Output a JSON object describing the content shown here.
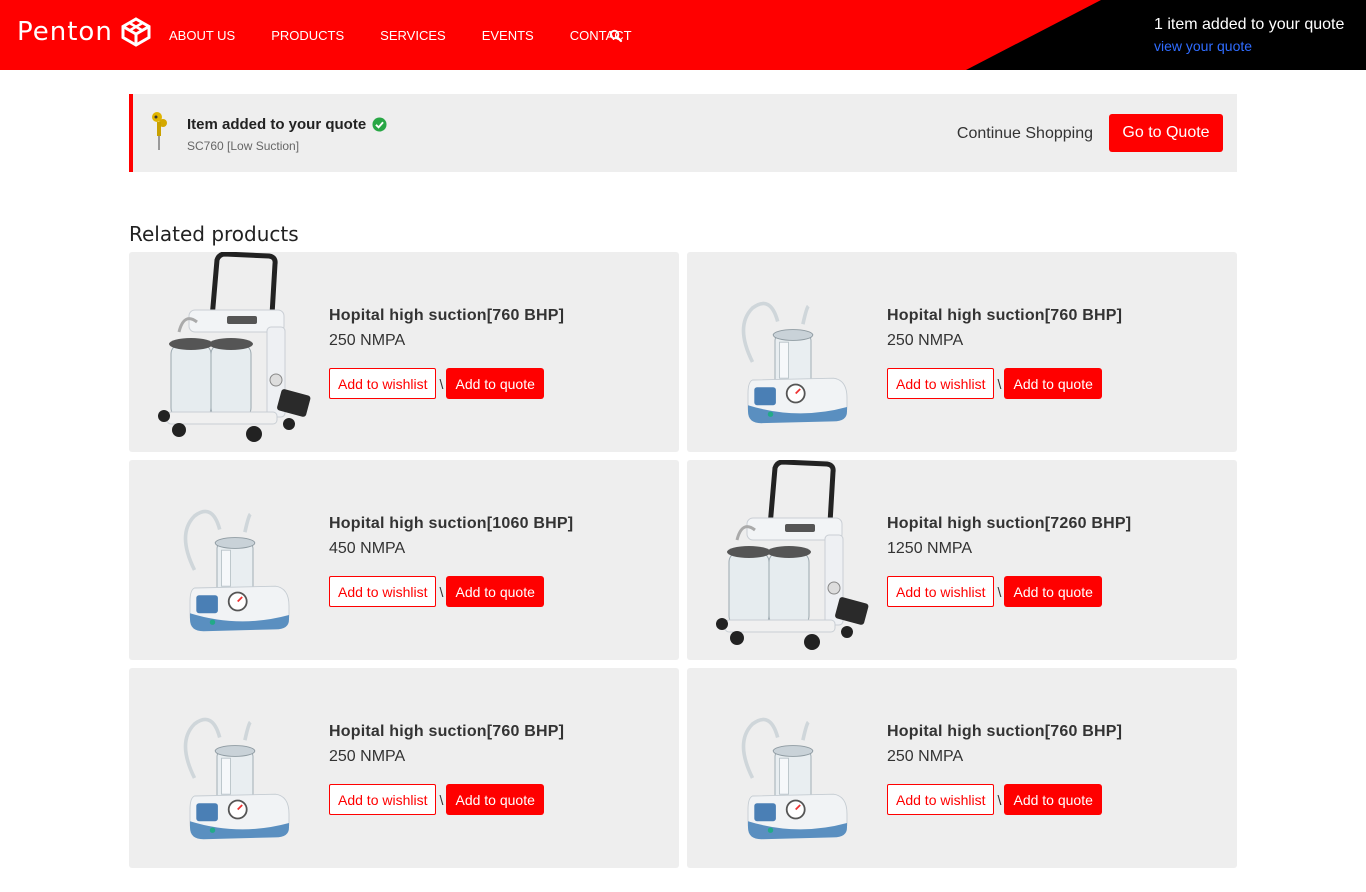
{
  "header": {
    "logo_text": "Penton",
    "nav": [
      "About us",
      "Products",
      "Services",
      "Events",
      "Contact"
    ],
    "quote_count_text": "1 item added to your quote",
    "quote_link_text": "view your quote"
  },
  "notice": {
    "title": "Item added to your quote",
    "subtitle": "SC760 [Low Suction]",
    "continue_label": "Continue Shopping",
    "goto_label": "Go to Quote"
  },
  "related": {
    "title": "Related products",
    "items": [
      {
        "name": "Hopital high suction[760 BHP]",
        "price": "250 NMPA",
        "wishlist": "Add to wishlist",
        "separator": "\\",
        "quote": "Add to quote",
        "image": "trolley"
      },
      {
        "name": "Hopital high suction[760 BHP]",
        "price": "250 NMPA",
        "wishlist": "Add to wishlist",
        "separator": "\\",
        "quote": "Add to quote",
        "image": "portable"
      },
      {
        "name": "Hopital high suction[1060 BHP]",
        "price": "450 NMPA",
        "wishlist": "Add to wishlist",
        "separator": "\\",
        "quote": "Add to quote",
        "image": "portable"
      },
      {
        "name": "Hopital high suction[7260 BHP]",
        "price": "1250 NMPA",
        "wishlist": "Add to wishlist",
        "separator": "\\",
        "quote": "Add to quote",
        "image": "trolley"
      },
      {
        "name": "Hopital high suction[760 BHP]",
        "price": "250 NMPA",
        "wishlist": "Add to wishlist",
        "separator": "\\",
        "quote": "Add to quote",
        "image": "portable"
      },
      {
        "name": "Hopital high suction[760 BHP]",
        "price": "250 NMPA",
        "wishlist": "Add to wishlist",
        "separator": "\\",
        "quote": "Add to quote",
        "image": "portable"
      }
    ]
  },
  "colors": {
    "brand": "#ff0000",
    "dark": "#000000",
    "link": "#2f6cff",
    "card_bg": "#eeeeee",
    "check": "#28a745"
  }
}
